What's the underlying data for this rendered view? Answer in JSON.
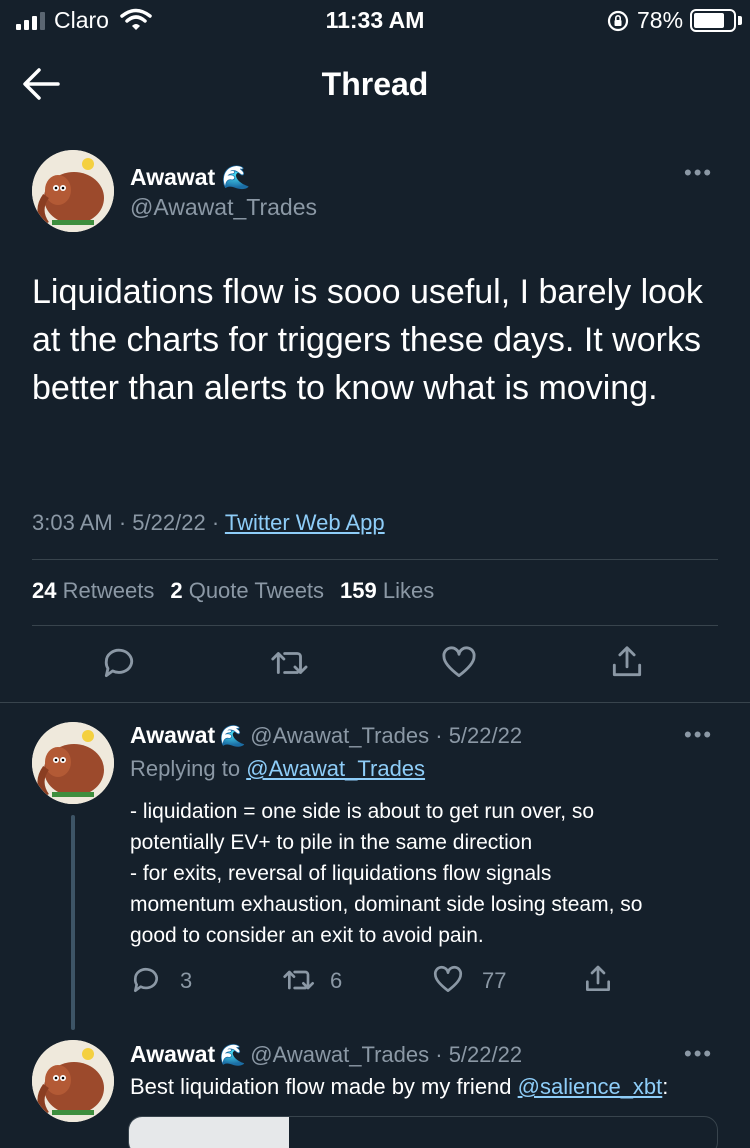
{
  "status_bar": {
    "carrier": "Claro",
    "time": "11:33 AM",
    "battery": "78%"
  },
  "header": {
    "title": "Thread"
  },
  "main_tweet": {
    "name": "Awawat",
    "name_emoji": "🌊",
    "handle": "@Awawat_Trades",
    "text": "Liquidations flow is sooo useful, I barely look at the charts for triggers these days. It works better than alerts to know what is moving.",
    "time": "3:03 AM",
    "date": "5/22/22",
    "source": "Twitter Web App",
    "retweets": "24",
    "retweets_label": "Retweets",
    "quotes": "2",
    "quotes_label": "Quote Tweets",
    "likes": "159",
    "likes_label": "Likes"
  },
  "reply_1": {
    "name": "Awawat",
    "handle_date": "@Awawat_Trades · 5/22/22",
    "replying_prefix": "Replying to ",
    "replying_to": "@Awawat_Trades",
    "lines": [
      "- liquidation = one side is about to get run over, so",
      "potentially EV+ to pile in the same direction",
      "- for exits, reversal of liquidations flow signals",
      "momentum exhaustion, dominant side losing steam, so",
      "good to consider an exit to avoid pain."
    ],
    "replies": "3",
    "retweets": "6",
    "likes": "77"
  },
  "reply_2": {
    "name": "Awawat",
    "handle_date": "@Awawat_Trades · 5/22/22",
    "text": "Best liquidation flow made by my friend ",
    "mention": "@salience_xbt",
    "suffix": ":"
  },
  "icons": {
    "back": "arrow-left-icon",
    "more": "more-icon",
    "reply": "reply-icon",
    "retweet": "retweet-icon",
    "like": "heart-icon",
    "share": "share-icon"
  },
  "colors": {
    "background": "#15202b",
    "secondary_text": "#8b98a5",
    "link": "#8ecdf8",
    "divider": "#38444d"
  }
}
